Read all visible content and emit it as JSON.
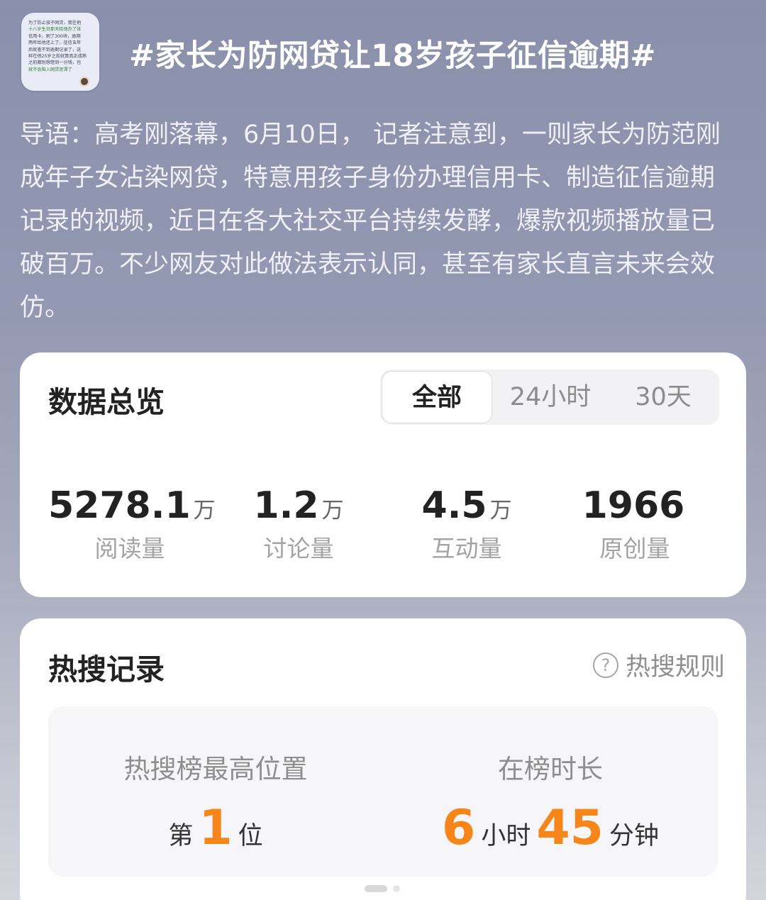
{
  "topic": {
    "title": "#家长为防网贷让18岁孩子征信逾期#",
    "thumbnail_lines": [
      "为了防止孩子网贷，我在他",
      "十八岁生日那天给他办了张",
      "信用卡，刷了300块，逾期",
      "两年给他还上了，征信五年",
      "后就查不到逾期记录了，这",
      "样在他25岁之前就算真正成熟",
      "之前都别想借到一分钱，也",
      "就不会陷入网贷泥潭了"
    ]
  },
  "lead": {
    "text": "导语：高考刚落幕，6月10日， 记者注意到，一则家长为防范刚成年子女沾染网贷，特意用孩子身份办理信用卡、制造征信逾期记录的视频，近日在各大社交平台持续发酵，爆款视频播放量已破百万。不少网友对此做法表示认同，甚至有家长直言未来会效仿。"
  },
  "overview": {
    "title": "数据总览",
    "tabs": [
      "全部",
      "24小时",
      "30天"
    ],
    "active_tab": "全部",
    "stats": [
      {
        "value": "5278.1",
        "unit": "万",
        "label": "阅读量"
      },
      {
        "value": "1.2",
        "unit": "万",
        "label": "讨论量"
      },
      {
        "value": "4.5",
        "unit": "万",
        "label": "互动量"
      },
      {
        "value": "1966",
        "unit": "",
        "label": "原创量"
      }
    ]
  },
  "hot": {
    "title": "热搜记录",
    "rules_label": "热搜规则",
    "rules_icon": "question-circle-icon",
    "highest_label": "热搜榜最高位置",
    "highest_prefix": "第",
    "highest_value": "1",
    "highest_suffix": "位",
    "duration_label": "在榜时长",
    "duration_hours": "6",
    "duration_hours_unit": "小时",
    "duration_minutes": "45",
    "duration_minutes_unit": "分钟"
  },
  "colors": {
    "accent": "#f6861a",
    "background_top": "#8a90ab",
    "card": "#ffffff"
  }
}
